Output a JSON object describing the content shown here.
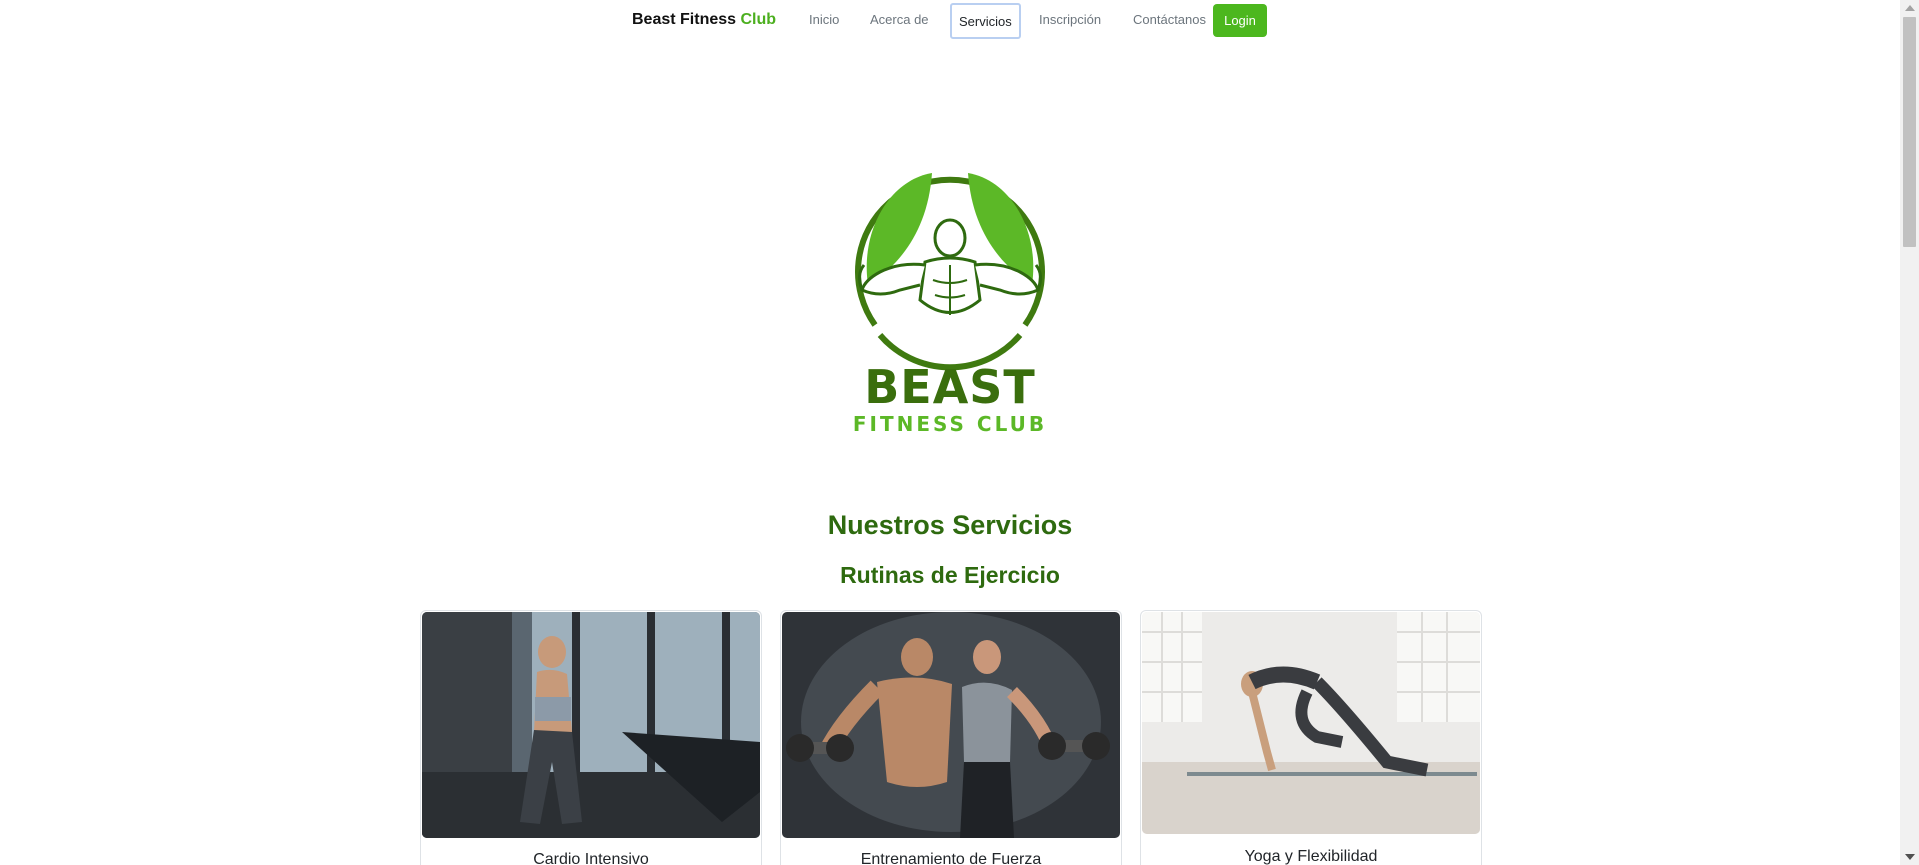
{
  "navbar": {
    "brand_main": "Beast Fitness",
    "brand_accent": "Club",
    "links": [
      {
        "label": "Inicio"
      },
      {
        "label": "Acerca de"
      },
      {
        "label": "Servicios"
      },
      {
        "label": "Inscripción"
      },
      {
        "label": "Contáctanos"
      }
    ],
    "active_link": "Servicios",
    "login_label": "Login"
  },
  "logo": {
    "line1": "BEAST",
    "line2": "FITNESS CLUB"
  },
  "main": {
    "heading": "Nuestros Servicios",
    "subheading": "Rutinas de Ejercicio",
    "cards": [
      {
        "title": "Cardio Intensivo"
      },
      {
        "title": "Entrenamiento de Fuerza"
      },
      {
        "title": "Yoga y Flexibilidad"
      }
    ]
  },
  "colors": {
    "accent_green": "#4cb71e",
    "dark_green": "#2e6a0f"
  }
}
